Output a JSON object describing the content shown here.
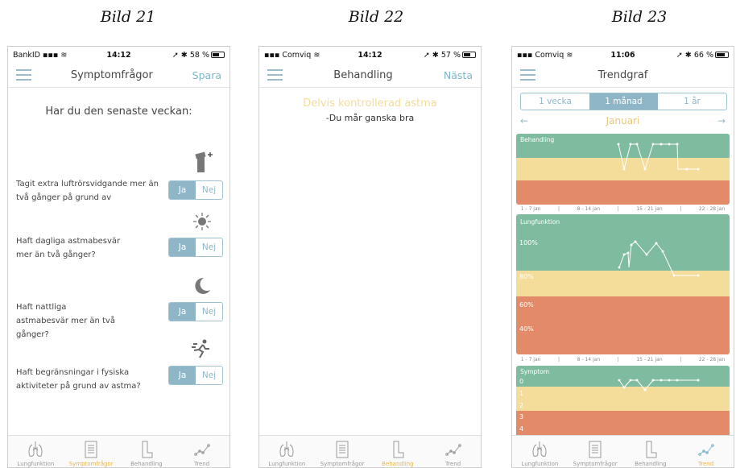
{
  "captions": [
    "Bild 21",
    "Bild 22",
    "Bild 23"
  ],
  "phones": [
    {
      "status": {
        "left": "BankID",
        "time": "14:12",
        "right": "58 %"
      },
      "nav": {
        "title": "Symptomfrågor",
        "action": "Spara"
      },
      "heading": "Har du den senaste veckan:",
      "questions": [
        {
          "text": "Tagit extra luftrörsvidgande mer än två gånger på grund av",
          "yes": "Ja",
          "no": "Nej"
        },
        {
          "text": "Haft dagliga astmabesvär mer än två gånger?",
          "yes": "Ja",
          "no": "Nej"
        },
        {
          "text": "Haft nattliga astmabesvär mer än två gånger?",
          "yes": "Ja",
          "no": "Nej"
        },
        {
          "text": "Haft begränsningar i fysiska aktiviteter på grund av astma?",
          "yes": "Ja",
          "no": "Nej"
        }
      ]
    },
    {
      "status": {
        "left": "Comviq",
        "time": "14:12",
        "right": "57 %"
      },
      "nav": {
        "title": "Behandling",
        "action": "Nästa"
      },
      "status_title": "Delvis kontrollerad astma",
      "status_sub": "-Du mår ganska bra"
    },
    {
      "status": {
        "left": "Comviq",
        "time": "11:06",
        "right": "66 %"
      },
      "nav": {
        "title": "Trendgraf"
      },
      "segments": [
        "1 vecka",
        "1 månad",
        "1 år"
      ],
      "month": "Januari",
      "weeks": [
        "1 - 7 jan",
        "|",
        "8 - 14 jan",
        "|",
        "15 - 21 jan",
        "|",
        "22 - 28 jan"
      ],
      "charts": {
        "behandling": {
          "label": "Behandling"
        },
        "lungfunktion": {
          "label": "Lungfunktion",
          "band_labels": [
            "100%",
            "80%",
            "60%",
            "40%"
          ]
        },
        "symptom": {
          "label": "Symptom",
          "band_labels": [
            "0",
            "1",
            "2",
            "3",
            "4"
          ]
        }
      }
    }
  ],
  "tabbar": [
    "Lungfunktion",
    "Symptomfrågor",
    "Behandling",
    "Trend"
  ],
  "colors": {
    "accent": "#8fb6c6",
    "green": "#7fbb9e",
    "yellow": "#f4dc9b",
    "orange": "#e38b68"
  }
}
